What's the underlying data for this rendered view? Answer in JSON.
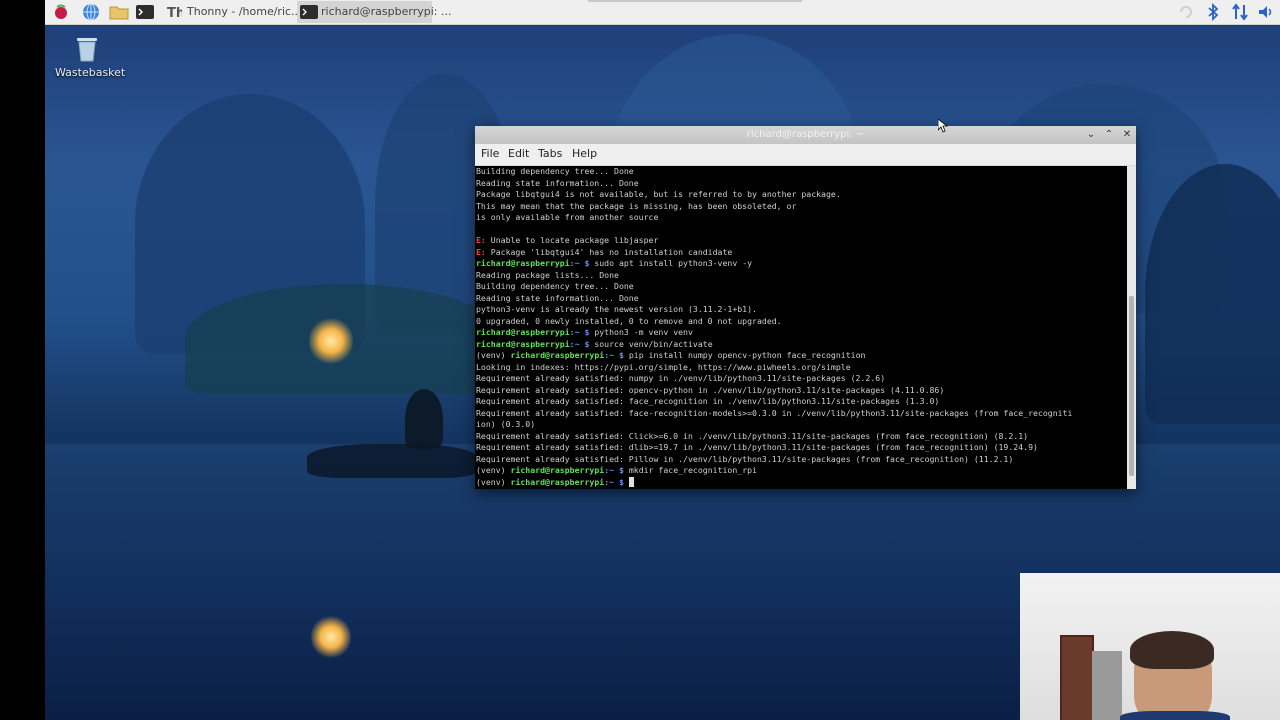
{
  "taskbar": {
    "tasks": [
      {
        "label": "Thonny  -  /home/ric..."
      },
      {
        "label": "richard@raspberrypi: ..."
      }
    ]
  },
  "desktop": {
    "wastebasket_label": "Wastebasket"
  },
  "terminal": {
    "title": "richard@raspberrypi: ~",
    "menu": [
      "File",
      "Edit",
      "Tabs",
      "Help"
    ],
    "lines": [
      [
        {
          "t": "Building dependency tree... Done",
          "c": "out"
        }
      ],
      [
        {
          "t": "Reading state information... Done",
          "c": "out"
        }
      ],
      [
        {
          "t": "Package libqtgui4 is not available, but is referred to by another package.",
          "c": "out"
        }
      ],
      [
        {
          "t": "This may mean that the package is missing, has been obsoleted, or",
          "c": "out"
        }
      ],
      [
        {
          "t": "is only available from another source",
          "c": "out"
        }
      ],
      [
        {
          "t": "",
          "c": "out"
        }
      ],
      [
        {
          "t": "E:",
          "c": "err"
        },
        {
          "t": " Unable to locate package libjasper",
          "c": "out"
        }
      ],
      [
        {
          "t": "E:",
          "c": "err"
        },
        {
          "t": " Package 'libqtgui4' has no installation candidate",
          "c": "out"
        }
      ],
      [
        {
          "t": "richard@raspberrypi",
          "c": "user"
        },
        {
          "t": ":~ $",
          "c": "path"
        },
        {
          "t": " sudo apt install python3-venv -y",
          "c": "out"
        }
      ],
      [
        {
          "t": "Reading package lists... Done",
          "c": "out"
        }
      ],
      [
        {
          "t": "Building dependency tree... Done",
          "c": "out"
        }
      ],
      [
        {
          "t": "Reading state information... Done",
          "c": "out"
        }
      ],
      [
        {
          "t": "python3-venv is already the newest version (3.11.2-1+b1).",
          "c": "out"
        }
      ],
      [
        {
          "t": "0 upgraded, 0 newly installed, 0 to remove and 0 not upgraded.",
          "c": "out"
        }
      ],
      [
        {
          "t": "richard@raspberrypi",
          "c": "user"
        },
        {
          "t": ":~ $",
          "c": "path"
        },
        {
          "t": " python3 -m venv venv",
          "c": "out"
        }
      ],
      [
        {
          "t": "richard@raspberrypi",
          "c": "user"
        },
        {
          "t": ":~ $",
          "c": "path"
        },
        {
          "t": " source venv/bin/activate",
          "c": "out"
        }
      ],
      [
        {
          "t": "(venv) ",
          "c": "out"
        },
        {
          "t": "richard@raspberrypi",
          "c": "user"
        },
        {
          "t": ":~ $",
          "c": "path"
        },
        {
          "t": " pip install numpy opencv-python face_recognition",
          "c": "out"
        }
      ],
      [
        {
          "t": "Looking in indexes: https://pypi.org/simple, https://www.piwheels.org/simple",
          "c": "out"
        }
      ],
      [
        {
          "t": "Requirement already satisfied: numpy in ./venv/lib/python3.11/site-packages (2.2.6)",
          "c": "out"
        }
      ],
      [
        {
          "t": "Requirement already satisfied: opencv-python in ./venv/lib/python3.11/site-packages (4.11.0.86)",
          "c": "out"
        }
      ],
      [
        {
          "t": "Requirement already satisfied: face_recognition in ./venv/lib/python3.11/site-packages (1.3.0)",
          "c": "out"
        }
      ],
      [
        {
          "t": "Requirement already satisfied: face-recognition-models>=0.3.0 in ./venv/lib/python3.11/site-packages (from face_recogniti",
          "c": "out"
        }
      ],
      [
        {
          "t": "ion) (0.3.0)",
          "c": "out"
        }
      ],
      [
        {
          "t": "Requirement already satisfied: Click>=6.0 in ./venv/lib/python3.11/site-packages (from face_recognition) (8.2.1)",
          "c": "out"
        }
      ],
      [
        {
          "t": "Requirement already satisfied: dlib>=19.7 in ./venv/lib/python3.11/site-packages (from face_recognition) (19.24.9)",
          "c": "out"
        }
      ],
      [
        {
          "t": "Requirement already satisfied: Pillow in ./venv/lib/python3.11/site-packages (from face_recognition) (11.2.1)",
          "c": "out"
        }
      ],
      [
        {
          "t": "(venv) ",
          "c": "out"
        },
        {
          "t": "richard@raspberrypi",
          "c": "user"
        },
        {
          "t": ":~ $",
          "c": "path"
        },
        {
          "t": " mkdir face_recognition_rpi",
          "c": "out"
        }
      ],
      [
        {
          "t": "(venv) ",
          "c": "out"
        },
        {
          "t": "richard@raspberrypi",
          "c": "user"
        },
        {
          "t": ":~ $",
          "c": "path"
        },
        {
          "t": " ",
          "c": "out"
        },
        {
          "t": "",
          "c": "cursor"
        }
      ]
    ]
  }
}
